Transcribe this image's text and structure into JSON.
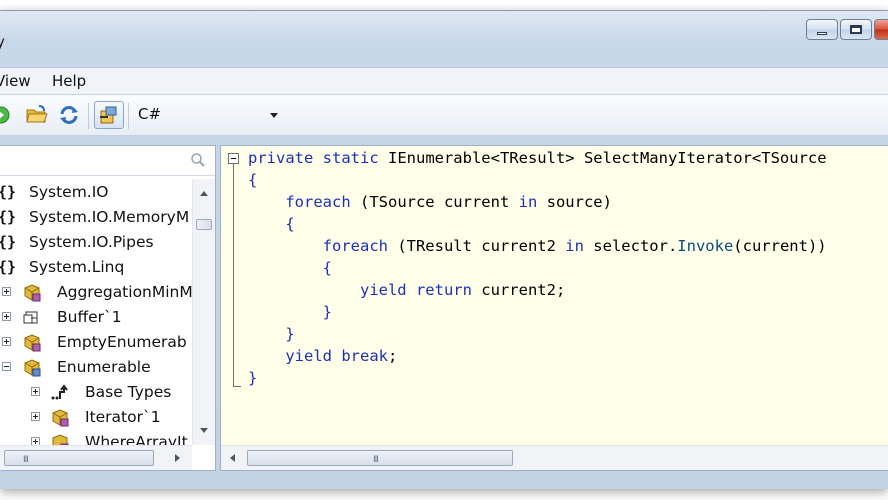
{
  "window": {
    "title": "y"
  },
  "menu": {
    "items": [
      "View",
      "Help"
    ]
  },
  "toolbar": {
    "buttons": [
      "go-icon",
      "open-folder-icon",
      "refresh-icon",
      "reference-icon"
    ],
    "language": "C#"
  },
  "tree": {
    "search_placeholder": "",
    "items": [
      {
        "label": "System.IO",
        "icon": "namespace-icon",
        "indent": 0
      },
      {
        "label": "System.IO.MemoryM",
        "icon": "namespace-icon",
        "indent": 0
      },
      {
        "label": "System.IO.Pipes",
        "icon": "namespace-icon",
        "indent": 0
      },
      {
        "label": "System.Linq",
        "icon": "namespace-icon",
        "indent": 0
      },
      {
        "label": "AggregationMinM",
        "icon": "class-icon",
        "indent": 1
      },
      {
        "label": "Buffer`1",
        "icon": "struct-icon",
        "indent": 1
      },
      {
        "label": "EmptyEnumerab",
        "icon": "class-icon",
        "indent": 1
      },
      {
        "label": "Enumerable",
        "icon": "class-icon",
        "indent": 1
      },
      {
        "label": "Base Types",
        "icon": "base-types-icon",
        "indent": 2
      },
      {
        "label": "Iterator`1",
        "icon": "class-icon",
        "indent": 2
      },
      {
        "label": "WhereArrayIt",
        "icon": "class-icon",
        "indent": 2
      }
    ]
  },
  "code": {
    "lines": [
      "private static IEnumerable<TResult> SelectManyIterator<TSource",
      "{",
      "    foreach (TSource current in source)",
      "    {",
      "        foreach (TResult current2 in selector.Invoke(current))",
      "        {",
      "            yield return current2;",
      "        }",
      "    }",
      "    yield break;",
      "}"
    ]
  },
  "scrollbar": {
    "grip": "III"
  },
  "colors": {
    "code_background": "#ffffe9",
    "keyword": "#1e2fb8",
    "text": "#000000"
  }
}
